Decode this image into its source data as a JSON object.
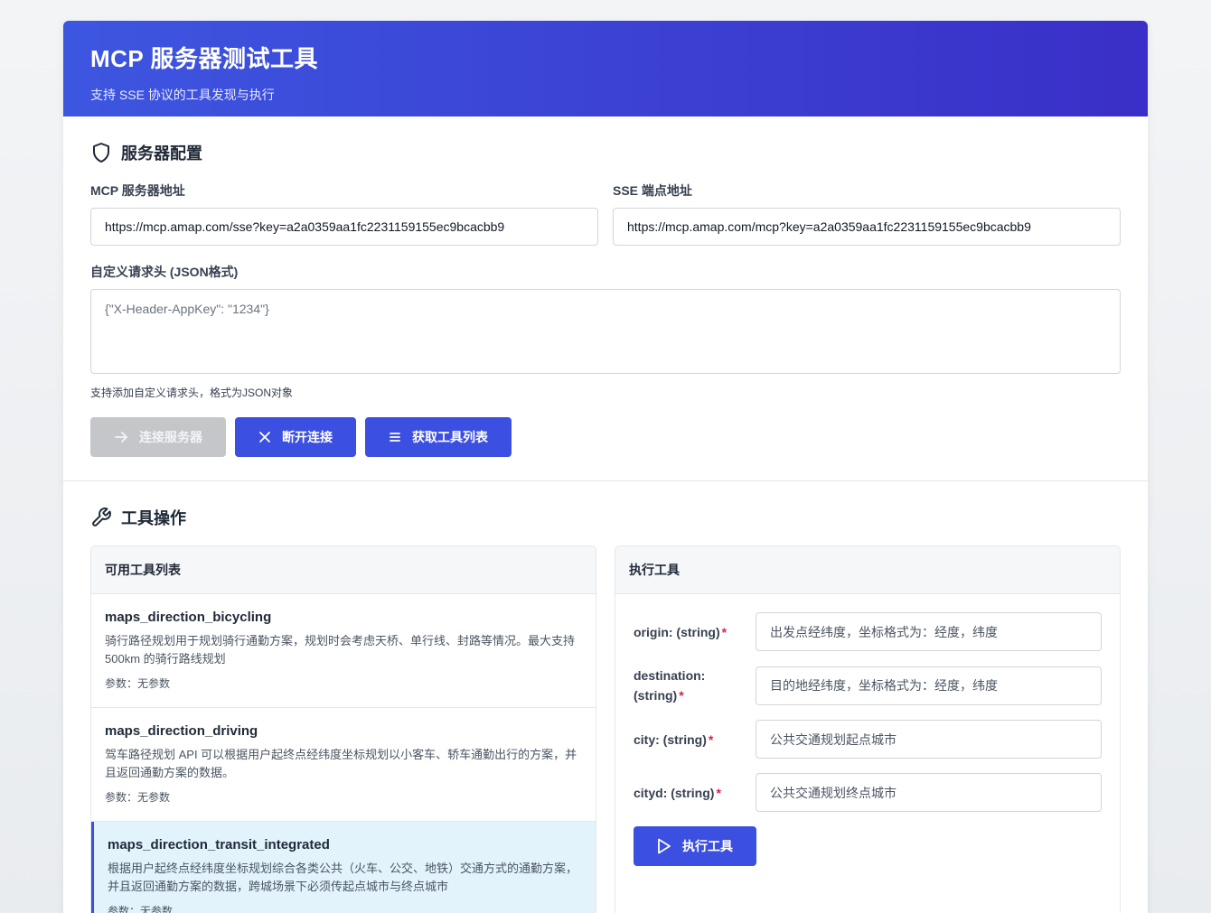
{
  "header": {
    "title": "MCP 服务器测试工具",
    "subtitle": "支持 SSE 协议的工具发现与执行"
  },
  "config": {
    "section_title": "服务器配置",
    "server_label": "MCP 服务器地址",
    "server_value": "https://mcp.amap.com/sse?key=a2a0359aa1fc2231159155ec9bcacbb9",
    "sse_label": "SSE 端点地址",
    "sse_value": "https://mcp.amap.com/mcp?key=a2a0359aa1fc2231159155ec9bcacbb9",
    "headers_label": "自定义请求头 (JSON格式)",
    "headers_placeholder": "{\"X-Header-AppKey\": \"1234\"}",
    "headers_hint": "支持添加自定义请求头，格式为JSON对象",
    "connect_label": "连接服务器",
    "disconnect_label": "断开连接",
    "fetch_tools_label": "获取工具列表"
  },
  "tools_section": {
    "title": "工具操作",
    "list_title": "可用工具列表",
    "tools": [
      {
        "name": "maps_direction_bicycling",
        "desc": "骑行路径规划用于规划骑行通勤方案，规划时会考虑天桥、单行线、封路等情况。最大支持 500km 的骑行路线规划",
        "params": "参数：无参数"
      },
      {
        "name": "maps_direction_driving",
        "desc": "驾车路径规划 API 可以根据用户起终点经纬度坐标规划以小客车、轿车通勤出行的方案，并且返回通勤方案的数据。",
        "params": "参数：无参数"
      },
      {
        "name": "maps_direction_transit_integrated",
        "desc": "根据用户起终点经纬度坐标规划综合各类公共（火车、公交、地铁）交通方式的通勤方案，并且返回通勤方案的数据，跨城场景下必须传起点城市与终点城市",
        "params": "参数：无参数"
      }
    ],
    "exec_title": "执行工具",
    "exec_fields": [
      {
        "label": "origin: (string)",
        "placeholder": "出发点经纬度，坐标格式为：经度，纬度"
      },
      {
        "label": "destination: (string)",
        "placeholder": "目的地经纬度，坐标格式为：经度，纬度"
      },
      {
        "label": "city: (string)",
        "placeholder": "公共交通规划起点城市"
      },
      {
        "label": "cityd: (string)",
        "placeholder": "公共交通规划终点城市"
      }
    ],
    "required_mark": "*",
    "exec_button": "执行工具"
  },
  "colors": {
    "primary": "#3b4fe0",
    "header_start": "#3d56e0",
    "header_end": "#3a2fc8",
    "active_bg": "#e2f3fc",
    "required": "#e11d48"
  }
}
